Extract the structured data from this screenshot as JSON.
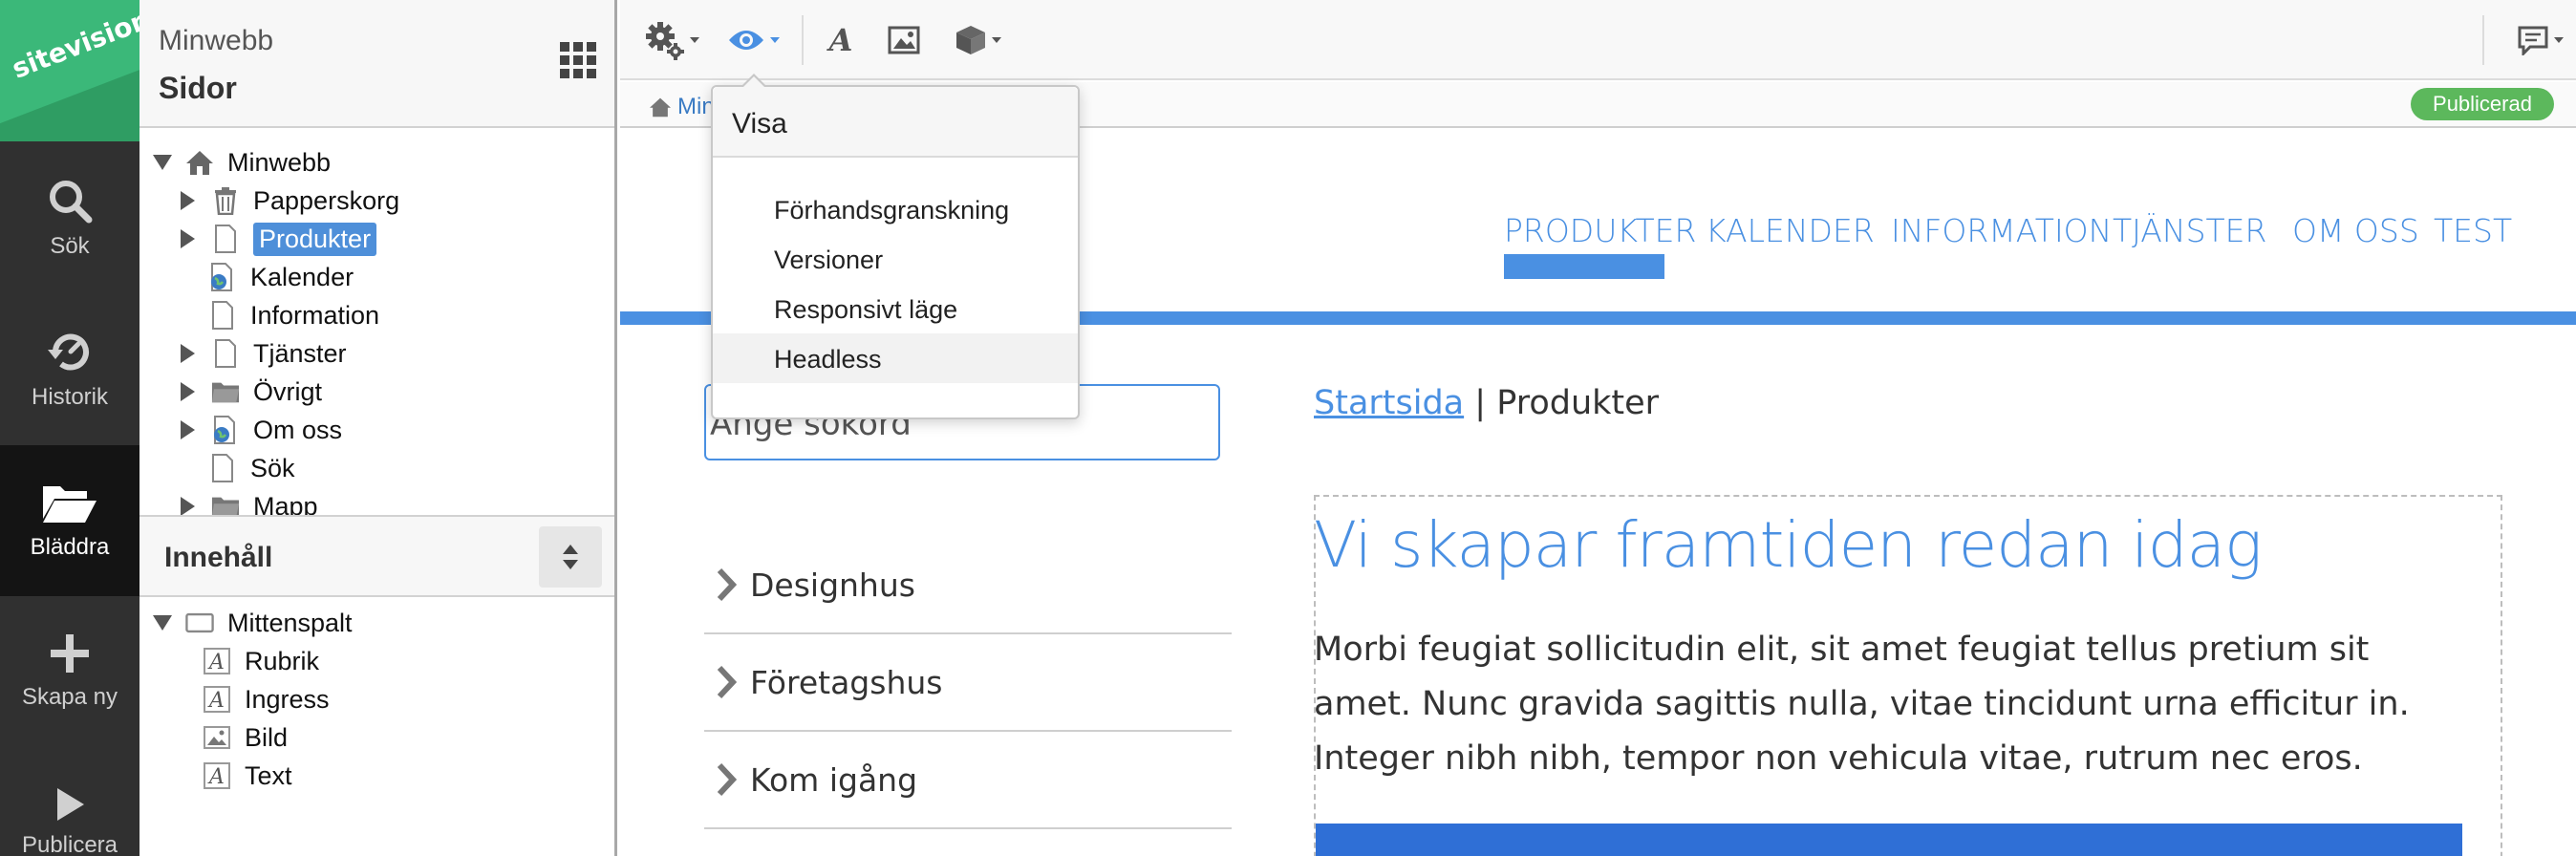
{
  "brand": {
    "logo_text": "sitevision.",
    "colors": {
      "green": "#3bb879",
      "rail": "#303030",
      "accent": "#4a90e2",
      "published": "#5cb85c"
    }
  },
  "rail": {
    "items": [
      {
        "label": "Sök",
        "icon": "search-icon"
      },
      {
        "label": "Historik",
        "icon": "history-icon"
      },
      {
        "label": "Bläddra",
        "icon": "folder-open-icon",
        "active": true
      },
      {
        "label": "Skapa ny",
        "icon": "plus-icon"
      },
      {
        "label": "Publicera",
        "icon": "play-icon"
      }
    ]
  },
  "panel": {
    "site_name": "Minwebb",
    "section_title": "Sidor",
    "tree": [
      {
        "label": "Minwebb",
        "icon": "home-icon",
        "expander": "open"
      },
      {
        "label": "Papperskorg",
        "icon": "trash-icon",
        "expander": "closed"
      },
      {
        "label": "Produkter",
        "icon": "page-icon",
        "expander": "closed",
        "selected": true
      },
      {
        "label": "Kalender",
        "icon": "globe-page-icon",
        "expander": "none"
      },
      {
        "label": "Information",
        "icon": "page-icon",
        "expander": "none"
      },
      {
        "label": "Tjänster",
        "icon": "page-icon",
        "expander": "closed"
      },
      {
        "label": "Övrigt",
        "icon": "folder-icon",
        "expander": "closed"
      },
      {
        "label": "Om oss",
        "icon": "globe-page-icon",
        "expander": "closed"
      },
      {
        "label": "Sök",
        "icon": "page-icon",
        "expander": "none"
      },
      {
        "label": "Mapp",
        "icon": "folder-icon",
        "expander": "closed"
      }
    ],
    "content_title": "Innehåll",
    "content_tree": [
      {
        "label": "Mittenspalt",
        "icon": "container-icon",
        "expander": "open"
      },
      {
        "label": "Rubrik",
        "icon": "text-module-icon"
      },
      {
        "label": "Ingress",
        "icon": "text-module-icon"
      },
      {
        "label": "Bild",
        "icon": "image-module-icon"
      },
      {
        "label": "Text",
        "icon": "text-module-icon"
      }
    ]
  },
  "toolbar": {
    "buttons": [
      {
        "icon": "gears-icon"
      },
      {
        "icon": "eye-icon"
      },
      {
        "icon": "text-format-icon"
      },
      {
        "icon": "image-icon"
      },
      {
        "icon": "cube-icon"
      },
      {
        "icon": "comments-icon"
      }
    ]
  },
  "crumbbar": {
    "home_text": "Min",
    "status": "Publicerad"
  },
  "dropdown": {
    "title": "Visa",
    "items": [
      "Förhandsgranskning",
      "Versioner",
      "Responsivt läge",
      "Headless"
    ]
  },
  "page": {
    "nav": [
      "PRODUKTER",
      "KALENDER",
      "INFORMATION",
      "TJÄNSTER",
      "OM OSS",
      "TEST"
    ],
    "search_placeholder": "Ange sökord",
    "side_nav": [
      "Designhus",
      "Företagshus",
      "Kom igång"
    ],
    "breadcrumb": {
      "link": "Startsida",
      "separator": "|",
      "current": "Produkter"
    },
    "headline": "Vi skapar framtiden redan idag",
    "lead": "Morbi feugiat sollicitudin elit, sit amet feugiat tellus pretium sit amet. Nunc gravida sagittis nulla, vitae tincidunt urna efficitur in. Integer nibh nibh, tempor non vehicula vitae, rutrum nec eros."
  }
}
